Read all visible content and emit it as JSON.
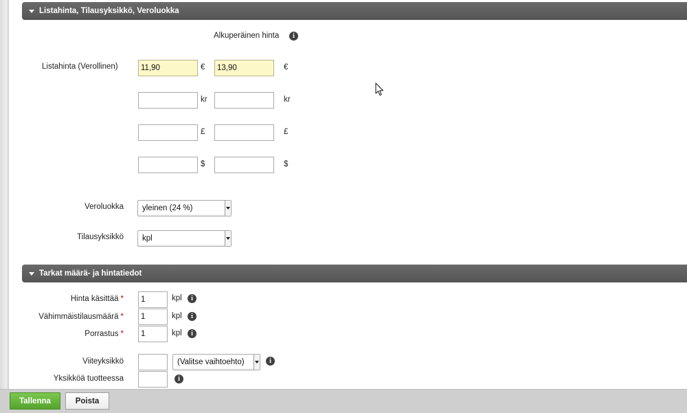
{
  "section_price": {
    "title": "Listahinta, Tilausyksikkö, Veroluokka",
    "original_price_label": "Alkuperäinen hinta",
    "list_price_label": "Listahinta (Verollinen)",
    "rows": [
      {
        "value": "11,90",
        "unit": "€",
        "original_value": "13,90",
        "original_unit": "€"
      },
      {
        "value": "",
        "unit": "kr",
        "original_value": "",
        "original_unit": "kr"
      },
      {
        "value": "",
        "unit": "£",
        "original_value": "",
        "original_unit": "£"
      },
      {
        "value": "",
        "unit": "$",
        "original_value": "",
        "original_unit": "$"
      }
    ],
    "tax_class_label": "Veroluokka",
    "tax_class_value": "yleinen (24 %)",
    "order_unit_label": "Tilausyksikkö",
    "order_unit_value": "kpl"
  },
  "section_quantity": {
    "title": "Tarkat määrä- ja hintatiedot",
    "price_covers_label": "Hinta käsittää",
    "price_covers_value": "1",
    "min_order_label": "Vähimmäistilausmäärä",
    "min_order_value": "1",
    "step_label": "Porrastus",
    "step_value": "1",
    "unit": "kpl",
    "required_mark": "*",
    "reference_unit_label": "Viiteyksikkö",
    "reference_unit_value": "",
    "reference_unit_select": "(Valitse vaihtoehto)",
    "units_in_product_label": "Yksikköä tuotteessa",
    "units_in_product_value": ""
  },
  "footer": {
    "save_label": "Tallenna",
    "delete_label": "Poista"
  },
  "icons": {
    "info": "i",
    "colors": {
      "header_bg": "#5e5e5e",
      "highlight_field": "#fdf8c8",
      "save_button": "#62b13a"
    }
  }
}
